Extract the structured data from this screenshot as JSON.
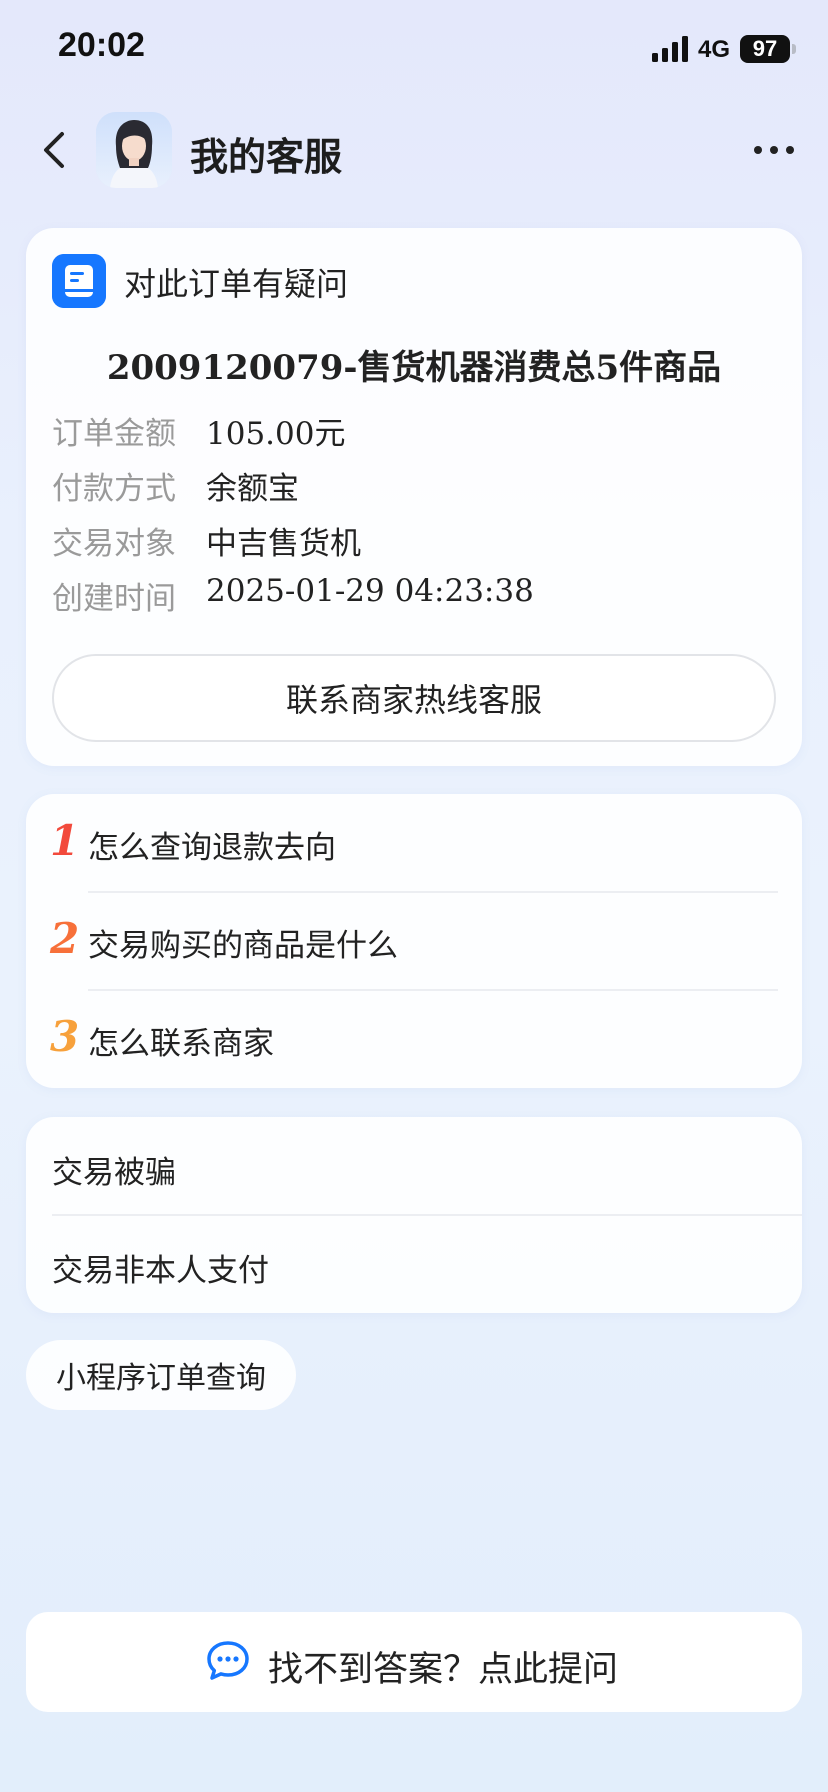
{
  "status_bar": {
    "time": "20:02",
    "network": "4G",
    "battery": "97"
  },
  "header": {
    "title": "我的客服"
  },
  "order_card": {
    "heading": "对此订单有疑问",
    "order_name": "2009120079-售货机器消费总5件商品",
    "details": [
      {
        "label": "订单金额",
        "value": "105.00元"
      },
      {
        "label": "付款方式",
        "value": "余额宝"
      },
      {
        "label": "交易对象",
        "value": "中吉售货机"
      },
      {
        "label": "创建时间",
        "value": "2025-01-29 04:23:38"
      }
    ],
    "hotline_button": "联系商家热线客服"
  },
  "faq": {
    "items": [
      {
        "number": "1",
        "text": "怎么查询退款去向",
        "color": "#f24a3c"
      },
      {
        "number": "2",
        "text": "交易购买的商品是什么",
        "color": "#f7703a"
      },
      {
        "number": "3",
        "text": "怎么联系商家",
        "color": "#f7a13c"
      }
    ]
  },
  "topics": {
    "items": [
      "交易被骗",
      "交易非本人支付"
    ]
  },
  "chip": {
    "label": "小程序订单查询"
  },
  "ask_bar": {
    "label": "找不到答案？点此提问",
    "icon": "chat-bubble-icon",
    "icon_color": "#1677ff"
  },
  "colors": {
    "accent": "#1677ff"
  }
}
